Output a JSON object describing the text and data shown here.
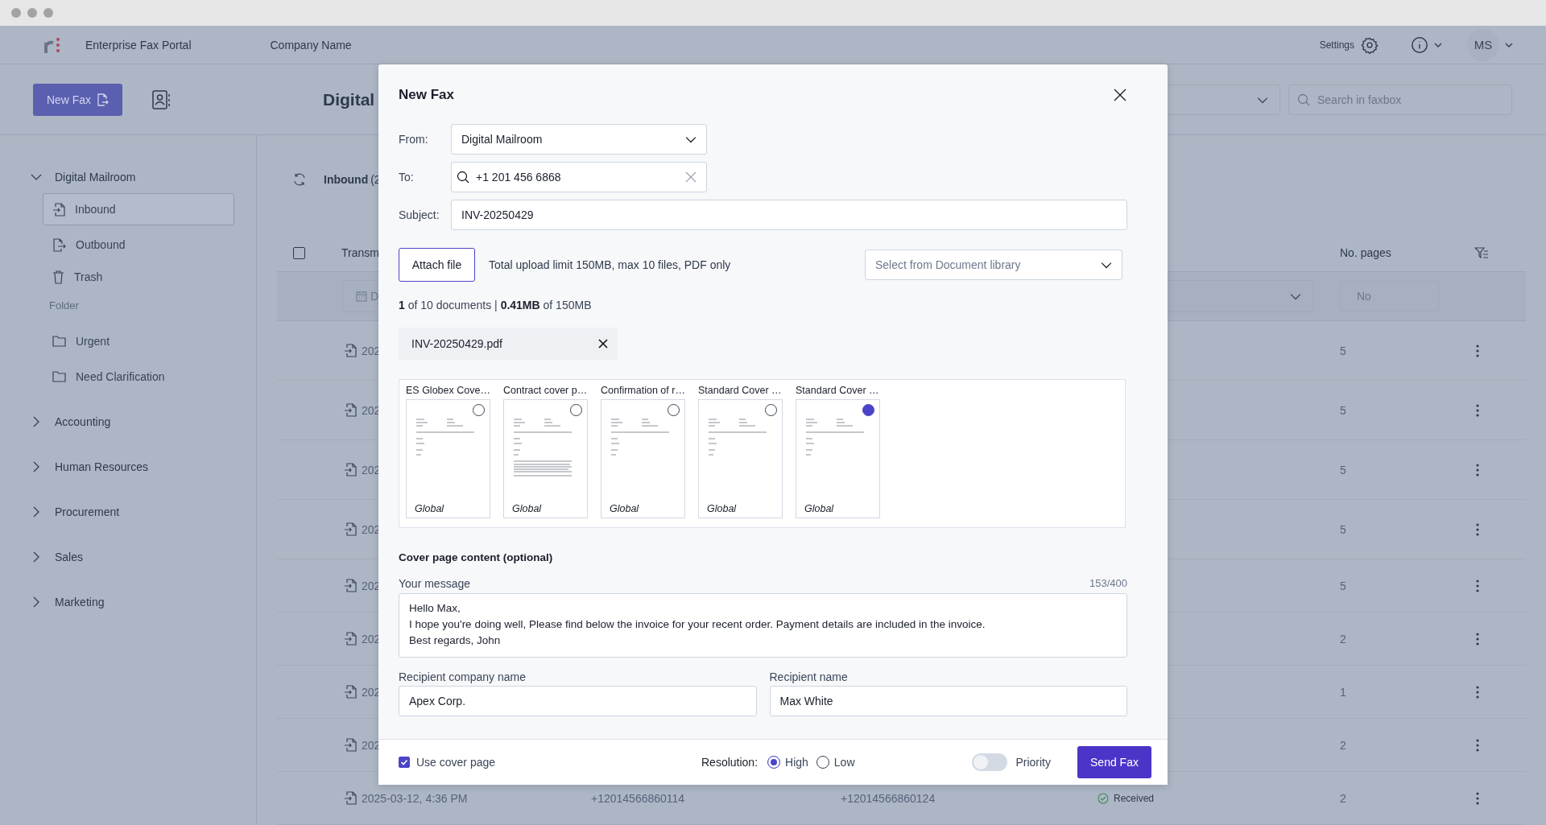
{
  "header": {
    "app_name": "Enterprise Fax Portal",
    "company": "Company Name",
    "settings": "Settings",
    "avatar": "MS"
  },
  "toolbar": {
    "new_fax": "New Fax",
    "page_title": "Digital",
    "search": {
      "placeholder": "Search in faxbox"
    }
  },
  "sidebar": {
    "groups": [
      {
        "label": "Digital Mailroom",
        "expanded": true,
        "children": [
          {
            "kind": "inbound",
            "label": "Inbound",
            "selected": true
          },
          {
            "kind": "outbound",
            "label": "Outbound",
            "selected": false
          },
          {
            "kind": "trash",
            "label": "Trash",
            "selected": false
          },
          {
            "kind": "heading",
            "label": "Folder",
            "selected": false
          },
          {
            "kind": "folder",
            "label": "Urgent",
            "selected": false
          },
          {
            "kind": "folder",
            "label": "Need Clarification",
            "selected": false
          }
        ]
      },
      {
        "label": "Accounting",
        "expanded": false
      },
      {
        "label": "Human Resources",
        "expanded": false
      },
      {
        "label": "Procurement",
        "expanded": false
      },
      {
        "label": "Sales",
        "expanded": false
      },
      {
        "label": "Marketing",
        "expanded": false
      }
    ]
  },
  "mailbox": {
    "title": "Inbound",
    "count": "(2",
    "select_all": {
      "checked": false
    },
    "columns": {
      "column_1": "Transm",
      "pages": "No. pages"
    },
    "date_filter": "D",
    "pages_filter": {
      "placeholder": "No"
    },
    "rows": [
      {
        "date": "202",
        "pages": "5"
      },
      {
        "date": "202",
        "pages": "5"
      },
      {
        "date": "202",
        "pages": "5"
      },
      {
        "date": "202",
        "pages": "5"
      },
      {
        "date": "202",
        "pages": "5"
      },
      {
        "date": "202",
        "pages": "2"
      },
      {
        "date": "202",
        "pages": "1"
      },
      {
        "date": "202",
        "pages": "2"
      },
      {
        "date": "2025-03-12, 4:36 PM",
        "from": "+12014566860114",
        "to": "+12014566860124",
        "status": "Received",
        "pages": "2"
      }
    ]
  },
  "dialog": {
    "title": "New Fax",
    "from": {
      "label": "From:",
      "value": "Digital Mailroom"
    },
    "to": {
      "label": "To:",
      "value": "+1 201 456 6868"
    },
    "subject": {
      "label": "Subject:",
      "value": "INV-20250429"
    },
    "attach_button": "Attach file",
    "upload_hint": "Total upload limit 150MB, max 10 files, PDF only",
    "library": {
      "placeholder": "Select from Document library"
    },
    "summary": "**1** of 10 documents | **0.41MB** of 150MB",
    "files": [
      {
        "name": "INV-20250429.pdf"
      }
    ],
    "templates": [
      {
        "title": "ES Globex Cove…",
        "tag": "Global",
        "selected": false
      },
      {
        "title": "Contract cover p…",
        "tag": "Global",
        "selected": false
      },
      {
        "title": "Confirmation of r…",
        "tag": "Global",
        "selected": false
      },
      {
        "title": "Standard Cover …",
        "tag": "Global",
        "selected": false
      },
      {
        "title": "Standard Cover …",
        "tag": "Global",
        "selected": true
      }
    ],
    "cover_heading": "Cover page content (optional)",
    "message": {
      "label": "Your message",
      "counter": "153/400",
      "value": "Hello Max,\nI hope you're doing well, Please find below the invoice for your recent order. Payment details are included in the invoice.\nBest regards, John"
    },
    "recipient_company": {
      "label": "Recipient company name",
      "value": "Apex Corp."
    },
    "recipient_name": {
      "label": "Recipient name",
      "value": "Max White"
    },
    "use_cover_page": {
      "label": "Use cover page",
      "checked": true
    },
    "resolution": {
      "label": "Resolution:",
      "options": [
        {
          "label": "High",
          "selected": true
        },
        {
          "label": "Low",
          "selected": false
        }
      ]
    },
    "priority": {
      "label": "Priority",
      "on": false
    },
    "send_button": "Send Fax"
  }
}
